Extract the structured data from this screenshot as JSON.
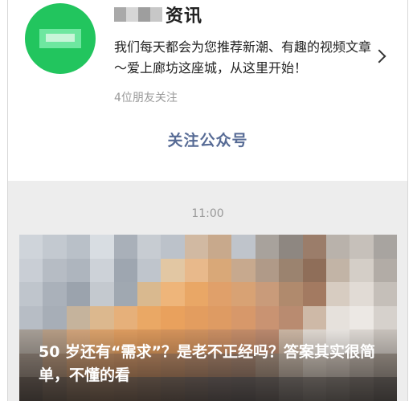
{
  "account": {
    "name_suffix": "资讯",
    "description": "我们每天都会为您推荐新潮、有趣的视频文章～爱上廊坊这座城，从这里开始！",
    "followers_text": "4位朋友关注",
    "follow_label": "关注公众号",
    "avatar_color": "#22c55e"
  },
  "feed": {
    "time": "11:00",
    "article": {
      "title": "50 岁还有“需求”？是老不正经吗？答案其实很简单，不懂的看"
    }
  },
  "colors": {
    "link": "#576b95",
    "muted": "#9a9a9a",
    "background": "#ededed"
  }
}
